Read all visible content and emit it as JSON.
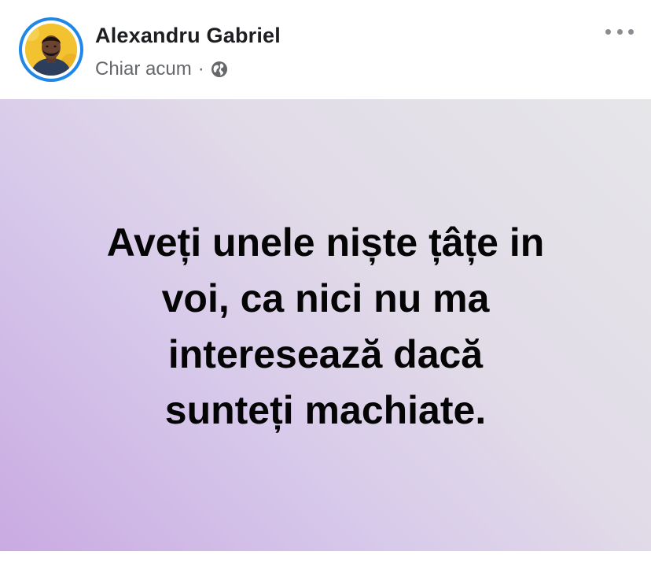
{
  "post": {
    "author_name": "Alexandru Gabriel",
    "timestamp": "Chiar acum",
    "separator": "·",
    "audience_icon": "globe-icon",
    "more_icon": "more-horizontal-icon",
    "text_line_1": "Aveți unele niște țâțe in",
    "text_line_2": "voi, ca nici nu ma",
    "text_line_3": "interesează dacă",
    "text_line_4": "sunteți machiate."
  },
  "colors": {
    "avatar_ring": "#1f87e8",
    "avatar_background": "#f2c230",
    "name_text": "#1c1e21",
    "meta_text": "#65676b",
    "background_gradient": [
      "#c9aae2",
      "#d7c9ea",
      "#e1dbe8",
      "#e6e6e9"
    ]
  }
}
